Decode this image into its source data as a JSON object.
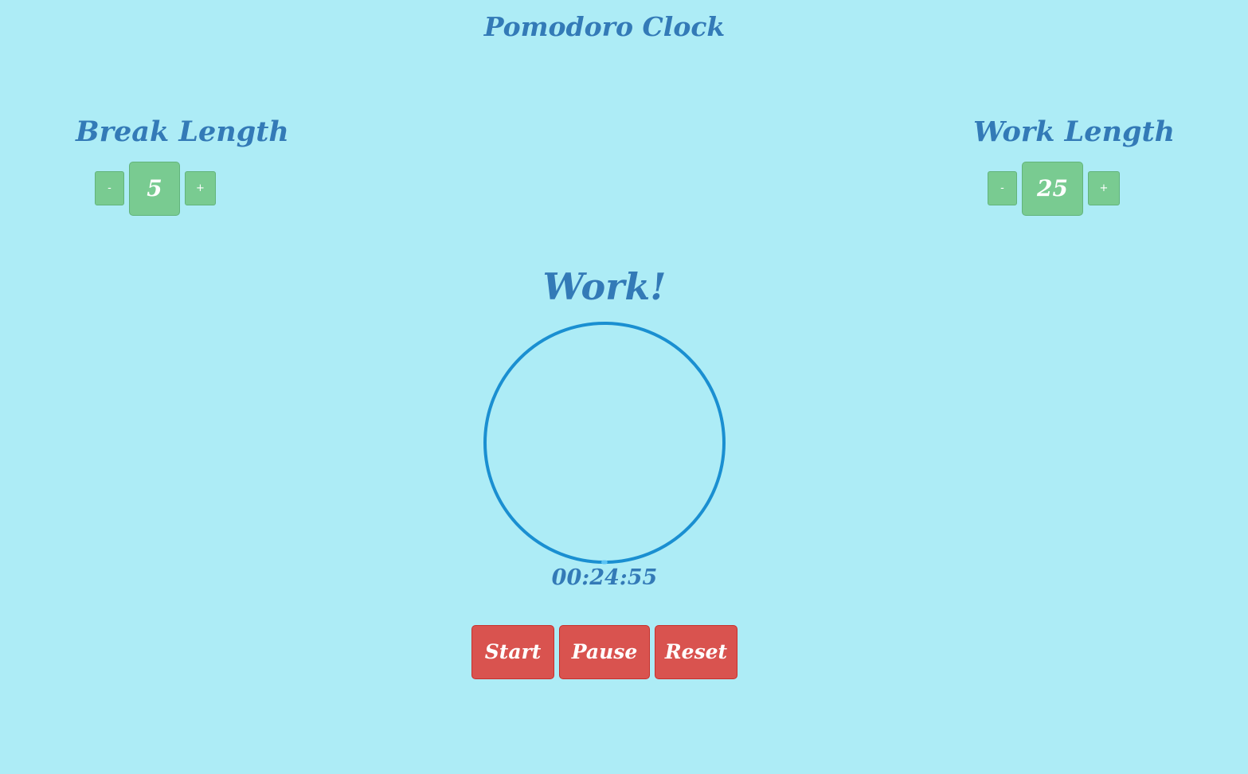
{
  "app": {
    "title": "Pomodoro Clock"
  },
  "break_setting": {
    "label": "Break Length",
    "minus": "-",
    "value": "5",
    "plus": "+"
  },
  "work_setting": {
    "label": "Work Length",
    "minus": "-",
    "value": "25",
    "plus": "+"
  },
  "timer": {
    "phase": "Work!",
    "time": "00:24:55",
    "progress_fraction": 0.003
  },
  "controls": {
    "start": "Start",
    "pause": "Pause",
    "reset": "Reset"
  },
  "colors": {
    "background": "#adecf6",
    "text": "#337ab7",
    "setting_button": "#79cb91",
    "control_button": "#d9534f",
    "ring": "#1a8fd1"
  }
}
